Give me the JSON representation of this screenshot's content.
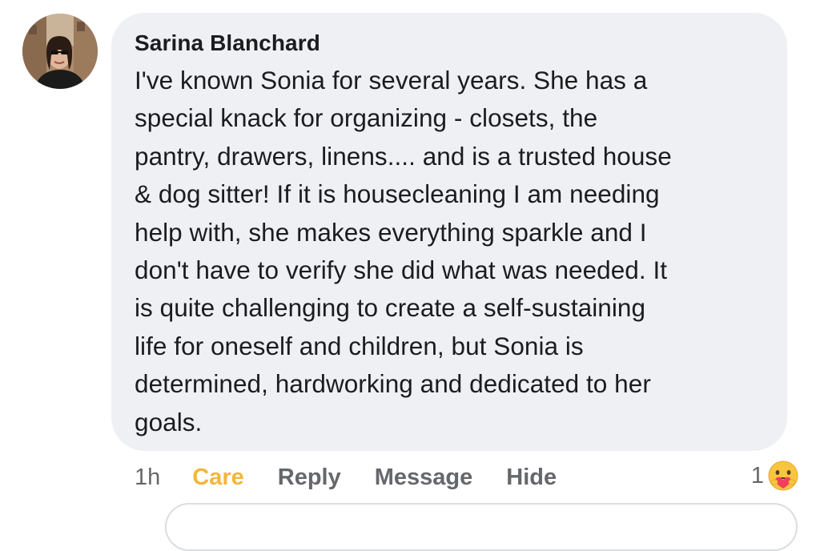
{
  "comment": {
    "author": "Sarina Blanchard",
    "text": "I've known Sonia for several years. She has a\nspecial knack for organizing - closets, the\npantry, drawers, linens.... and is a trusted house\n& dog sitter!  If it is housecleaning I am needing\nhelp with, she makes everything sparkle and I\ndon't have to verify she did what was needed.  It\nis quite challenging to create a self-sustaining\nlife for oneself and children, but Sonia is\ndetermined, hardworking and dedicated to her\ngoals."
  },
  "actions": {
    "time": "1h",
    "care": "Care",
    "reply": "Reply",
    "message": "Message",
    "hide": "Hide"
  },
  "reaction": {
    "count": "1",
    "icon": "care-emoji-icon"
  },
  "colors": {
    "bubble": "#eff0f3",
    "text": "#1c1c1e",
    "muted": "#65676b",
    "care_accent": "#f2b63d"
  }
}
